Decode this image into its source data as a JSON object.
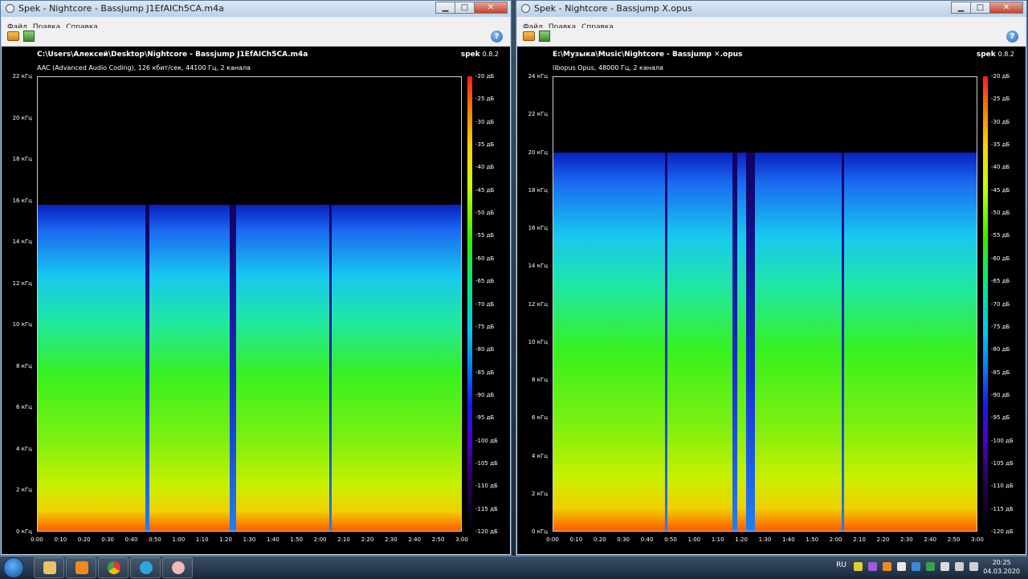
{
  "windows": [
    {
      "title": "Spek - Nightcore - Bassjump J1EfAICh5CA.m4a",
      "menu": [
        "Файл",
        "Правка",
        "Справка"
      ],
      "file_path": "C:\\Users\\Алексей\\Desktop\\Nightcore  - Bassjump J1EfAICh5CA.m4a",
      "file_info": "AAC (Advanced Audio Coding), 126 кбит/сек, 44100 Гц, 2 канала",
      "brand": "spek",
      "version": "0.8.2",
      "y_ticks": [
        "22 кГц",
        "20 кГц",
        "18 кГц",
        "16 кГц",
        "14 кГц",
        "12 кГц",
        "10 кГц",
        "8 кГц",
        "6 кГц",
        "4 кГц",
        "2 кГц",
        "0 кГц"
      ],
      "y_max_khz": 22,
      "cutoff_khz": 15.8,
      "x_ticks": [
        "0:00",
        "0:10",
        "0:20",
        "0:30",
        "0:40",
        "0:50",
        "1:00",
        "1:10",
        "1:20",
        "1:30",
        "1:40",
        "1:50",
        "2:00",
        "2:10",
        "2:20",
        "2:30",
        "2:40",
        "2:50",
        "3:00"
      ],
      "db_ticks": [
        "-20 дБ",
        "-25 дБ",
        "-30 дБ",
        "-35 дБ",
        "-40 дБ",
        "-45 дБ",
        "-50 дБ",
        "-55 дБ",
        "-60 дБ",
        "-65 дБ",
        "-70 дБ",
        "-75 дБ",
        "-80 дБ",
        "-85 дБ",
        "-90 дБ",
        "-95 дБ",
        "-100 дБ",
        "-105 дБ",
        "-110 дБ",
        "-115 дБ",
        "-120 дБ"
      ]
    },
    {
      "title": "Spek - Nightcore - Bassjump X.opus",
      "menu": [
        "Файл",
        "Правка",
        "Справка"
      ],
      "file_path": "E:\\Музыка\\Music\\Nightcore  - Bassjump ✕.opus",
      "file_info": "libopus Opus, 48000 Гц, 2 канала",
      "brand": "spek",
      "version": "0.8.2",
      "y_ticks": [
        "24 кГц",
        "22 кГц",
        "20 кГц",
        "18 кГц",
        "16 кГц",
        "14 кГц",
        "12 кГц",
        "10 кГц",
        "8 кГц",
        "6 кГц",
        "4 кГц",
        "2 кГц",
        "0 кГц"
      ],
      "y_max_khz": 24,
      "cutoff_khz": 20,
      "x_ticks": [
        "0:00",
        "0:10",
        "0:20",
        "0:30",
        "0:40",
        "0:50",
        "1:00",
        "1:10",
        "1:20",
        "1:30",
        "1:40",
        "1:50",
        "2:00",
        "2:10",
        "2:20",
        "2:30",
        "2:40",
        "2:50",
        "3:00"
      ],
      "db_ticks": [
        "-20 дБ",
        "-25 дБ",
        "-30 дБ",
        "-35 дБ",
        "-40 дБ",
        "-45 дБ",
        "-50 дБ",
        "-55 дБ",
        "-60 дБ",
        "-65 дБ",
        "-70 дБ",
        "-75 дБ",
        "-80 дБ",
        "-85 дБ",
        "-90 дБ",
        "-95 дБ",
        "-100 дБ",
        "-105 дБ",
        "-110 дБ",
        "-115 дБ",
        "-120 дБ"
      ]
    }
  ],
  "taskbar": {
    "lang": "RU",
    "time": "20:25",
    "date": "04.03.2020"
  }
}
